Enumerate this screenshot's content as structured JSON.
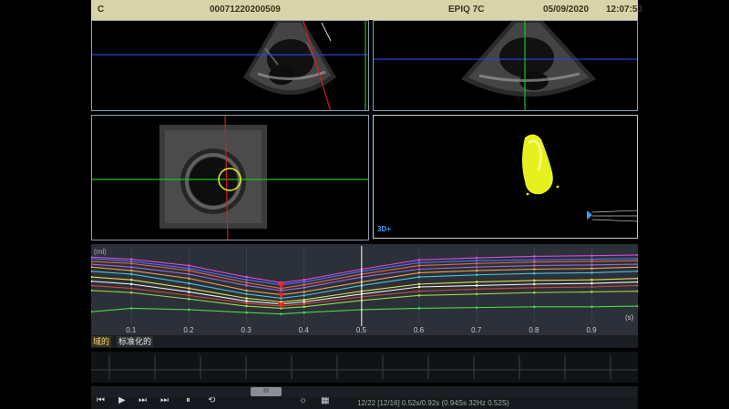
{
  "header": {
    "mode": "C",
    "patient_id": "00071220200509",
    "device": "EPIQ 7C",
    "date": "05/09/2020",
    "time": "12:07:53"
  },
  "viewport_3d": {
    "label": "3D+"
  },
  "chart_data": {
    "type": "line",
    "title": "",
    "ylabel": "(ml)",
    "xlabel": "",
    "x_ticks": [
      "0.1",
      "0.2",
      "0.3",
      "0.4",
      "0.5",
      "0.6",
      "0.7",
      "0.8",
      "0.9"
    ],
    "x_suffix": "(s)",
    "xlim": [
      0.03,
      0.98
    ],
    "x": [
      0.03,
      0.1,
      0.2,
      0.3,
      0.36,
      0.4,
      0.5,
      0.6,
      0.7,
      0.8,
      0.9,
      0.98
    ],
    "cursor_x": 0.5,
    "min_marker_x": 0.36,
    "series": [
      {
        "color": "#d84ad8",
        "values": [
          0.08,
          0.11,
          0.2,
          0.36,
          0.44,
          0.4,
          0.25,
          0.12,
          0.09,
          0.07,
          0.06,
          0.05
        ]
      },
      {
        "color": "#4a70ff",
        "values": [
          0.1,
          0.14,
          0.24,
          0.4,
          0.47,
          0.43,
          0.28,
          0.16,
          0.13,
          0.12,
          0.11,
          0.1
        ]
      },
      {
        "color": "#e06a3a",
        "values": [
          0.14,
          0.17,
          0.27,
          0.44,
          0.52,
          0.47,
          0.32,
          0.2,
          0.17,
          0.15,
          0.14,
          0.13
        ]
      },
      {
        "color": "#9a6ad8",
        "values": [
          0.18,
          0.22,
          0.32,
          0.48,
          0.55,
          0.51,
          0.36,
          0.25,
          0.22,
          0.2,
          0.19,
          0.18
        ]
      },
      {
        "color": "#e8a24a",
        "values": [
          0.22,
          0.27,
          0.38,
          0.55,
          0.61,
          0.57,
          0.43,
          0.3,
          0.27,
          0.25,
          0.24,
          0.22
        ]
      },
      {
        "color": "#48c0e0",
        "values": [
          0.28,
          0.32,
          0.45,
          0.6,
          0.66,
          0.62,
          0.48,
          0.36,
          0.33,
          0.31,
          0.3,
          0.28
        ]
      },
      {
        "color": "#e0e04a",
        "values": [
          0.36,
          0.4,
          0.52,
          0.66,
          0.71,
          0.68,
          0.56,
          0.46,
          0.43,
          0.41,
          0.4,
          0.38
        ]
      },
      {
        "color": "#f0f0f0",
        "values": [
          0.42,
          0.46,
          0.57,
          0.7,
          0.74,
          0.71,
          0.6,
          0.5,
          0.48,
          0.46,
          0.45,
          0.43
        ]
      },
      {
        "color": "#c84a3a",
        "values": [
          0.48,
          0.52,
          0.62,
          0.73,
          0.77,
          0.74,
          0.64,
          0.56,
          0.53,
          0.51,
          0.5,
          0.48
        ]
      },
      {
        "color": "#9ad84a",
        "values": [
          0.55,
          0.58,
          0.67,
          0.77,
          0.8,
          0.78,
          0.69,
          0.62,
          0.6,
          0.58,
          0.57,
          0.56
        ]
      },
      {
        "color": "#48d848",
        "values": [
          0.85,
          0.8,
          0.82,
          0.86,
          0.88,
          0.86,
          0.82,
          0.8,
          0.79,
          0.78,
          0.78,
          0.77
        ]
      }
    ]
  },
  "tabs": [
    {
      "label": "域的"
    },
    {
      "label": "标准化的"
    }
  ],
  "scrollbar": {
    "thumb": "III"
  },
  "controls": {
    "status": "12/22   [12/16]  0.52s/0.92s  (0.94Ss 32Hz  0.52S)"
  },
  "colors": {
    "header_bg": "#d9d3aa",
    "viewport_border": "#8e9bb0",
    "crosshair_green": "#19c21e",
    "crosshair_blue": "#2f3fd8",
    "crosshair_red": "#d01e1e",
    "model": "#e6f01e"
  }
}
